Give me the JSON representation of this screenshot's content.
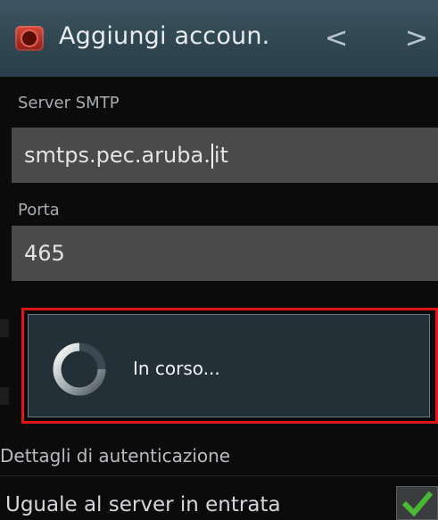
{
  "action_bar": {
    "title": "Aggiungi accoun.",
    "app_icon": "email-app-icon",
    "prev_icon": "chevron-left-icon",
    "next_icon": "chevron-right-icon",
    "prev_glyph": "<",
    "next_glyph": ">"
  },
  "form": {
    "smtp_server_label": "Server SMTP",
    "smtp_server_value_before_cursor": "smtps.pec.aruba.",
    "smtp_server_value_after_cursor": "it",
    "port_label": "Porta",
    "port_value": "465"
  },
  "progress_dialog": {
    "message": "In corso...",
    "highlight_color": "#e01515"
  },
  "auth": {
    "section_label": "Dettagli di autenticazione",
    "same_as_incoming_label": "Uguale al server in entrata",
    "same_as_incoming_checked": true,
    "check_color": "#49b834"
  }
}
